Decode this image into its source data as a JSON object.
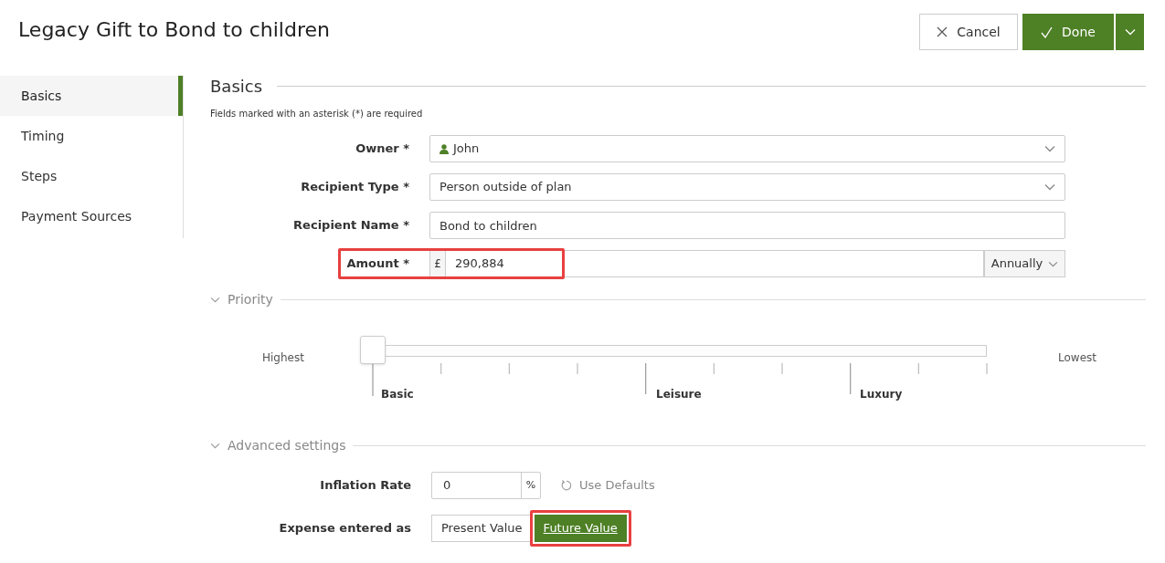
{
  "header": {
    "title": "Legacy Gift to Bond to children",
    "buttons": [
      {
        "kind": "cancel",
        "label": "Cancel"
      },
      {
        "kind": "done",
        "label": "Done"
      },
      {
        "kind": "menu"
      }
    ]
  },
  "sidebar": {
    "items": [
      {
        "label": "Basics",
        "selected": true
      },
      {
        "label": "Timing",
        "selected": false
      },
      {
        "label": "Steps",
        "selected": false
      },
      {
        "label": "Payment Sources",
        "selected": false
      }
    ]
  },
  "basics": {
    "title": "Basics",
    "note": "Fields marked with an asterisk (*) are required",
    "fields": [
      {
        "kind": "owner-select",
        "label": "Owner *",
        "value": "John"
      },
      {
        "kind": "select",
        "label": "Recipient Type *",
        "value": "Person outside of plan"
      },
      {
        "kind": "text",
        "label": "Recipient Name *",
        "value": "Bond to children"
      },
      {
        "kind": "amount",
        "label": "Amount *",
        "prefix": "£",
        "value": "290,884",
        "frequency": "Annually",
        "highlighted": true
      }
    ]
  },
  "priority": {
    "title": "Priority",
    "expanded": true,
    "start_label": "Highest",
    "end_label": "Lowest",
    "level": 0,
    "tiers": [
      "Basic",
      "Leisure",
      "Luxury"
    ]
  },
  "advanced": {
    "title": "Advanced settings",
    "expanded": true,
    "inflation": {
      "label": "Inflation Rate",
      "value": "0",
      "unit": "%",
      "defaults_label": "Use Defaults"
    },
    "expense": {
      "label": "Expense entered as",
      "options": [
        {
          "label": "Present Value",
          "selected": false,
          "highlighted": false
        },
        {
          "label": "Future Value",
          "selected": true,
          "highlighted": true
        }
      ]
    }
  }
}
